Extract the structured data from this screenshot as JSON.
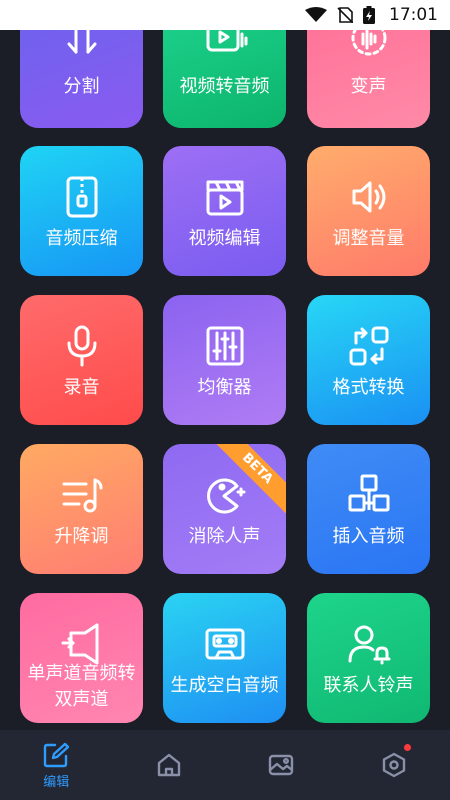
{
  "status_bar": {
    "time": "17:01"
  },
  "tiles": [
    {
      "label": "分割"
    },
    {
      "label": "视频转音频"
    },
    {
      "label": "变声"
    },
    {
      "label": "音频压缩"
    },
    {
      "label": "视频编辑"
    },
    {
      "label": "调整音量"
    },
    {
      "label": "录音"
    },
    {
      "label": "均衡器"
    },
    {
      "label": "格式转换"
    },
    {
      "label": "升降调"
    },
    {
      "label": "消除人声",
      "badge": "BETA"
    },
    {
      "label": "插入音频"
    },
    {
      "label": "单声道音频转\n双声道"
    },
    {
      "label": "生成空白音频"
    },
    {
      "label": "联系人铃声"
    }
  ],
  "nav": {
    "edit_label": "编辑",
    "active_color": "#2f9cff",
    "inactive_color": "#8a90a8"
  }
}
